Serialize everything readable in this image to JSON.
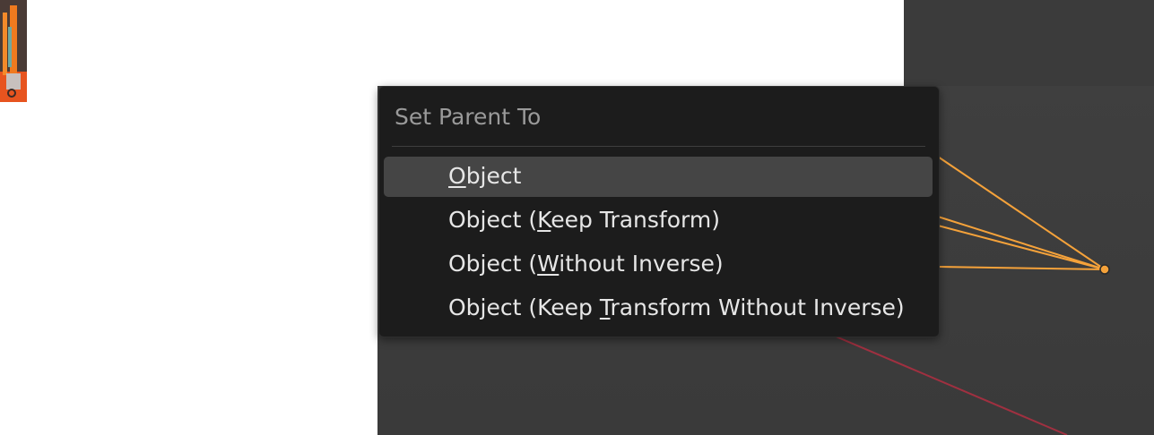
{
  "menu": {
    "title": "Set Parent To",
    "items": [
      {
        "before": "",
        "key": "O",
        "after": "bject",
        "active": true
      },
      {
        "before": "Object (",
        "key": "K",
        "after": "eep Transform)",
        "active": false
      },
      {
        "before": "Object (",
        "key": "W",
        "after": "ithout Inverse)",
        "active": false
      },
      {
        "before": "Object (Keep ",
        "key": "T",
        "after": "ransform Without Inverse)",
        "active": false
      }
    ]
  },
  "colors": {
    "menu_background": "#1c1c1c",
    "menu_highlight": "#454545",
    "menu_text": "#e6e6e6",
    "title_text": "#9a9a9a",
    "viewport_background": "#3d3d3d",
    "relationship_line": "#f5a23a",
    "axis_line": "#a03040",
    "thumbnail_accent": "#e7541f"
  }
}
